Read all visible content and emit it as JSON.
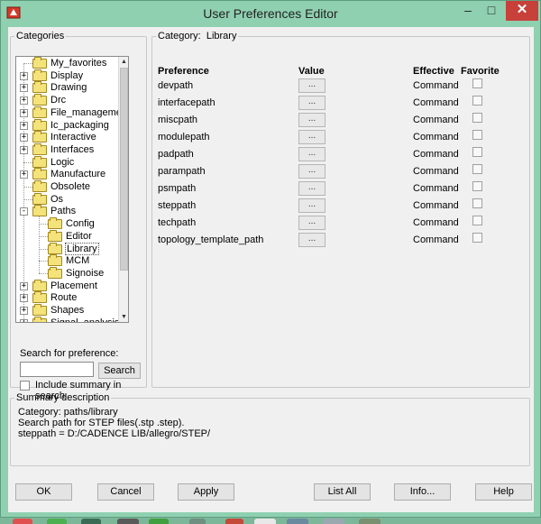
{
  "window": {
    "title": "User Preferences Editor",
    "minimize_glyph": "–",
    "maximize_glyph": "□",
    "close_glyph": "✕",
    "app_icon": "app-logo-icon"
  },
  "categories": {
    "group_label": "Categories",
    "items": [
      {
        "label": "My_favorites",
        "expandable": false,
        "level": 0
      },
      {
        "label": "Display",
        "expandable": true,
        "level": 0
      },
      {
        "label": "Drawing",
        "expandable": true,
        "level": 0
      },
      {
        "label": "Drc",
        "expandable": true,
        "level": 0
      },
      {
        "label": "File_management",
        "expandable": true,
        "level": 0
      },
      {
        "label": "Ic_packaging",
        "expandable": true,
        "level": 0
      },
      {
        "label": "Interactive",
        "expandable": true,
        "level": 0
      },
      {
        "label": "Interfaces",
        "expandable": true,
        "level": 0
      },
      {
        "label": "Logic",
        "expandable": false,
        "level": 0
      },
      {
        "label": "Manufacture",
        "expandable": true,
        "level": 0
      },
      {
        "label": "Obsolete",
        "expandable": false,
        "level": 0
      },
      {
        "label": "Os",
        "expandable": false,
        "level": 0
      },
      {
        "label": "Paths",
        "expandable": true,
        "expanded": true,
        "level": 0
      },
      {
        "label": "Config",
        "expandable": false,
        "level": 1
      },
      {
        "label": "Editor",
        "expandable": false,
        "level": 1
      },
      {
        "label": "Library",
        "expandable": false,
        "level": 1,
        "selected": true
      },
      {
        "label": "MCM",
        "expandable": false,
        "level": 1
      },
      {
        "label": "Signoise",
        "expandable": false,
        "level": 1
      },
      {
        "label": "Placement",
        "expandable": true,
        "level": 0
      },
      {
        "label": "Route",
        "expandable": true,
        "level": 0
      },
      {
        "label": "Shapes",
        "expandable": true,
        "level": 0
      },
      {
        "label": "Signal_analysis",
        "expandable": true,
        "level": 0
      }
    ],
    "scroll_up_glyph": "▲",
    "scroll_down_glyph": "▼"
  },
  "search": {
    "label": "Search for preference:",
    "value": "",
    "button": "Search",
    "include_summary_label": "Include summary in search",
    "include_summary_checked": false
  },
  "category_panel": {
    "label_prefix": "Category:",
    "label_value": "Library",
    "headers": {
      "preference": "Preference",
      "value": "Value",
      "effective": "Effective",
      "favorite": "Favorite"
    },
    "rows": [
      {
        "name": "devpath",
        "value_button": "...",
        "effective": "Command",
        "favorite": false
      },
      {
        "name": "interfacepath",
        "value_button": "...",
        "effective": "Command",
        "favorite": false
      },
      {
        "name": "miscpath",
        "value_button": "...",
        "effective": "Command",
        "favorite": false
      },
      {
        "name": "modulepath",
        "value_button": "...",
        "effective": "Command",
        "favorite": false
      },
      {
        "name": "padpath",
        "value_button": "...",
        "effective": "Command",
        "favorite": false
      },
      {
        "name": "parampath",
        "value_button": "...",
        "effective": "Command",
        "favorite": false
      },
      {
        "name": "psmpath",
        "value_button": "...",
        "effective": "Command",
        "favorite": false
      },
      {
        "name": "steppath",
        "value_button": "...",
        "effective": "Command",
        "favorite": false
      },
      {
        "name": "techpath",
        "value_button": "...",
        "effective": "Command",
        "favorite": false
      },
      {
        "name": "topology_template_path",
        "value_button": "...",
        "effective": "Command",
        "favorite": false
      }
    ]
  },
  "summary": {
    "group_label": "Summary description",
    "lines": [
      "Category: paths/library",
      "Search path for STEP files(.stp .step).",
      "steppath = D:/CADENCE LIB/allegro/STEP/"
    ]
  },
  "buttons": {
    "ok": "OK",
    "cancel": "Cancel",
    "apply": "Apply",
    "list_all": "List All",
    "info": "Info...",
    "help": "Help"
  },
  "colors": {
    "window_frame": "#8fd0b0",
    "close_button": "#c7403a",
    "dialog_background": "#f0f0f0",
    "folder_fill": "#f4e27a"
  }
}
